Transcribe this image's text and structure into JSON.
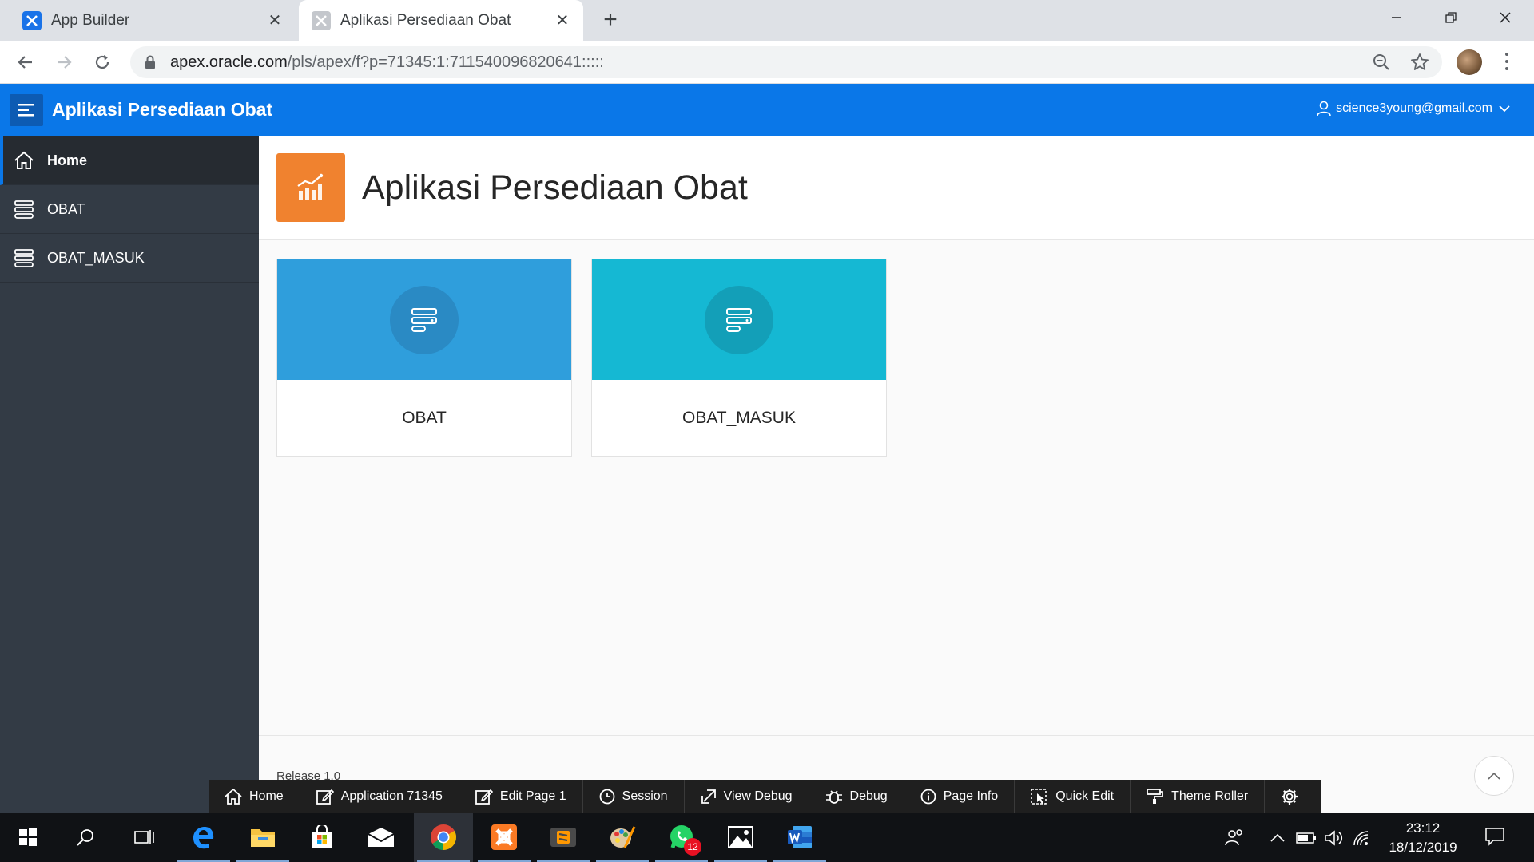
{
  "browser": {
    "tabs": [
      {
        "title": "App Builder",
        "active": false
      },
      {
        "title": "Aplikasi Persediaan Obat",
        "active": true
      }
    ],
    "url_host": "apex.oracle.com",
    "url_path": "/pls/apex/f?p=71345:1:711540096820641:::::"
  },
  "app": {
    "title": "Aplikasi Persediaan Obat",
    "user": "science3young@gmail.com"
  },
  "sidebar": {
    "items": [
      {
        "label": "Home",
        "icon": "home-icon",
        "current": true
      },
      {
        "label": "OBAT",
        "icon": "database-icon",
        "current": false
      },
      {
        "label": "OBAT_MASUK",
        "icon": "database-icon",
        "current": false
      }
    ]
  },
  "page": {
    "title": "Aplikasi Persediaan Obat",
    "cards": [
      {
        "label": "OBAT",
        "color": "#2f9edc",
        "circle": "#2a8ac4"
      },
      {
        "label": "OBAT_MASUK",
        "color": "#15b8d3",
        "circle": "#139fb8"
      }
    ],
    "release": "Release 1.0"
  },
  "dev_toolbar": {
    "items": [
      "Home",
      "Application 71345",
      "Edit Page 1",
      "Session",
      "View Debug",
      "Debug",
      "Page Info",
      "Quick Edit",
      "Theme Roller"
    ]
  },
  "taskbar": {
    "whatsapp_badge": "12",
    "time": "23:12",
    "date": "18/12/2019"
  },
  "colors": {
    "header": "#0a77e8",
    "sidebar": "#333b45",
    "hero_icon": "#f0822f"
  }
}
